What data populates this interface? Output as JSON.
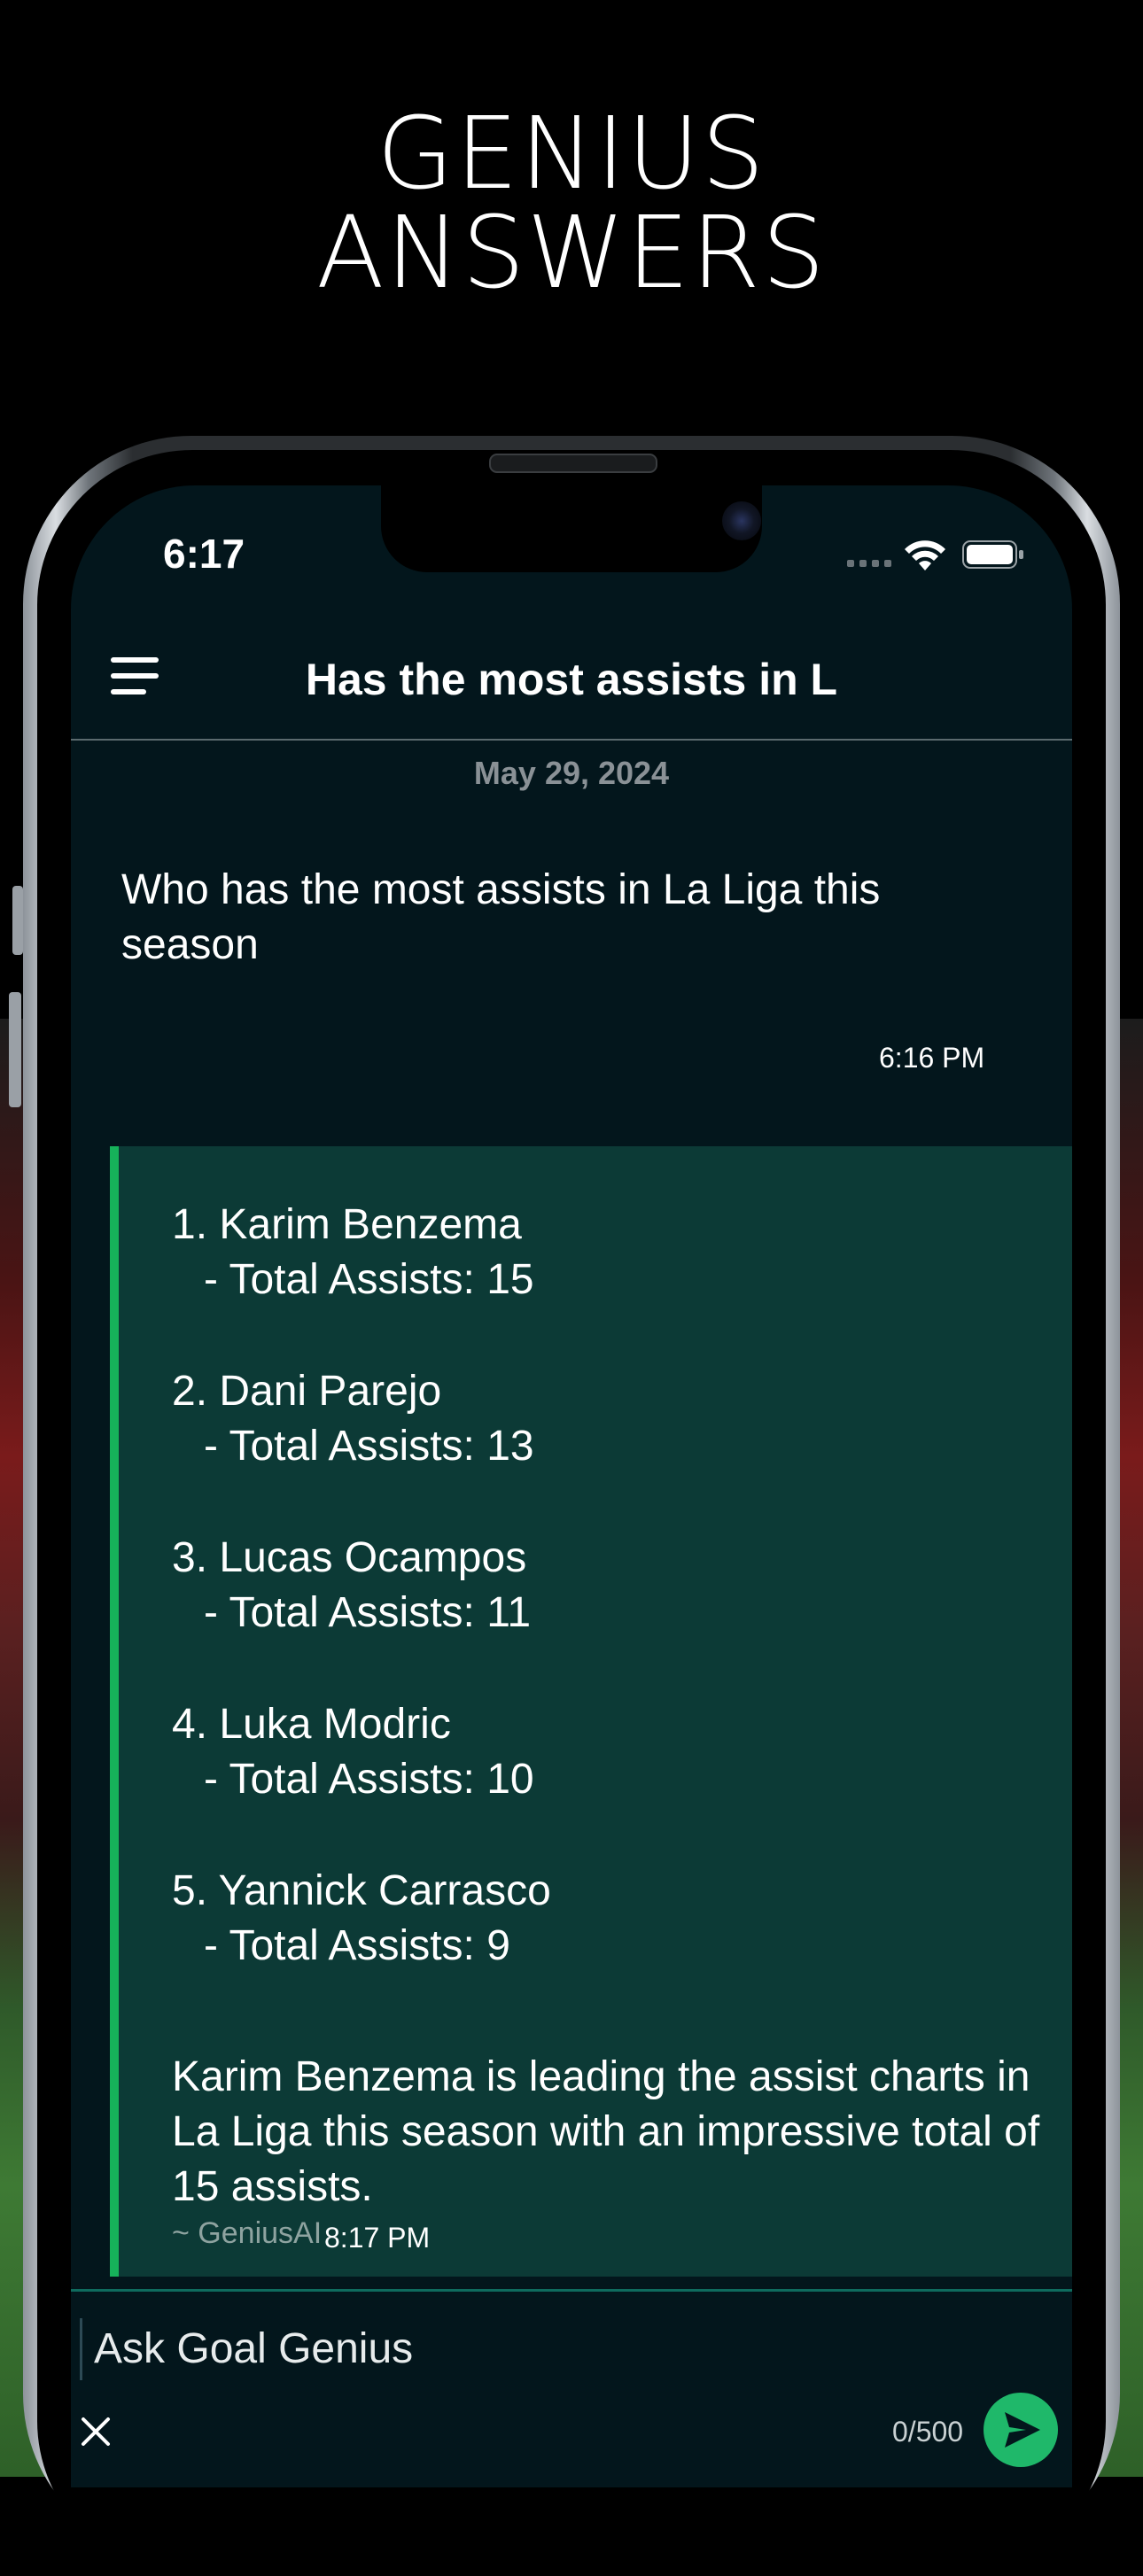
{
  "headline": {
    "line1": "GENIUS",
    "line2": "ANSWERS"
  },
  "status_bar": {
    "time": "6:17"
  },
  "header": {
    "title": "Has the most assists in L"
  },
  "conversation": {
    "date": "May 29, 2024",
    "user_message": {
      "text": "Who has the most assists in La Liga this season",
      "time": "6:16 PM"
    },
    "ai_message": {
      "items": [
        {
          "title": "1. Karim Benzema",
          "detail": "- Total Assists: 15"
        },
        {
          "title": "2. Dani Parejo",
          "detail": "- Total Assists: 13"
        },
        {
          "title": "3. Lucas Ocampos",
          "detail": "- Total Assists: 11"
        },
        {
          "title": "4. Luka Modric",
          "detail": "- Total Assists: 10"
        },
        {
          "title": "5. Yannick Carrasco",
          "detail": "- Total Assists: 9"
        }
      ],
      "summary": "Karim Benzema is leading the assist charts in La Liga this season with an impressive total of 15 assists.",
      "signature": "~ GeniusAI",
      "time": "8:17 PM"
    }
  },
  "input": {
    "placeholder": "Ask Goal Genius",
    "value": "",
    "counter": "0/500"
  },
  "colors": {
    "accent": "#1fb86a",
    "background": "#03161c",
    "ai_bubble": "#0c3a36"
  }
}
